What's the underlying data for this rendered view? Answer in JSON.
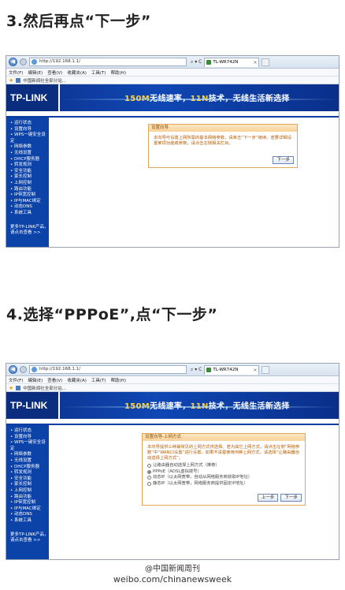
{
  "steps": [
    {
      "title": "3.然后再点“下一步”",
      "browser": {
        "url": "http://192.168.1.1/",
        "tab_title": "TL-WR742N",
        "menu": [
          "文件(F)",
          "编辑(E)",
          "查看(V)",
          "收藏夹(A)",
          "工具(T)",
          "帮助(H)"
        ],
        "favorites_item": "中国新闻社全部分站...",
        "tools_glyph": "⌕ ▾ C"
      },
      "page": {
        "logo": "TP-LINK",
        "slogan_a": "150M",
        "slogan_b": "无线速率，",
        "slogan_c": "11N",
        "slogan_d": "技术，无线生活新选择",
        "sidebar": [
          "运行状态",
          "设置向导",
          "WPS一键安全设定",
          "网络参数",
          "无线设置",
          "DHCP服务器",
          "转发规则",
          "安全功能",
          "家长控制",
          "上网控制",
          "路由功能",
          "IP带宽控制",
          "IP与MAC绑定",
          "动态DNS",
          "系统工具"
        ],
        "more": [
          "更多TP-LINK产品，",
          "请点击查看 >>"
        ],
        "dialog_title": "设置向导",
        "dialog_text": "本向导可设置上网所需的基本网络参数，请单击“下一步”继续。若要详细设置某项功能或参数，请点击左侧相关栏目。",
        "next_label": "下一步"
      }
    },
    {
      "title": "4.选择“PPPoE”,点“下一步”",
      "browser": {
        "url": "http://192.168.1.1/",
        "tab_title": "TL-WR742N",
        "menu": [
          "文件(F)",
          "编辑(E)",
          "查看(V)",
          "收藏夹(A)",
          "工具(T)",
          "帮助(H)"
        ],
        "favorites_item": "中国新闻社全部分站...",
        "tools_glyph": "⌕ ▾ C"
      },
      "page": {
        "logo": "TP-LINK",
        "slogan_a": "150M",
        "slogan_b": "无线速率，",
        "slogan_c": "11N",
        "slogan_d": "技术，无线生活新选择",
        "sidebar": [
          "运行状态",
          "设置向导",
          "WPS一键安全设定",
          "网络参数",
          "无线设置",
          "DHCP服务器",
          "转发规则",
          "安全功能",
          "家长控制",
          "上网控制",
          "路由功能",
          "IP带宽控制",
          "IP与MAC绑定",
          "动态DNS",
          "系统工具"
        ],
        "more": [
          "更多TP-LINK产品，",
          "请点击查看 >>"
        ],
        "dialog_title": "设置向导-上网方式",
        "dialog_text": "本向导提供三种最常见的上网方式供选择。若为其它上网方式，请点击左侧“网络参数”中“WAN口设置”进行设置。如果不清楚使用何种上网方式，请选择“让路由器自动选择上网方式”。",
        "options": [
          {
            "label": "让路由器自动选择上网方式（推荐）",
            "selected": false
          },
          {
            "label": "PPPoE（ADSL虚拟拨号）",
            "selected": true
          },
          {
            "label": "动态IP（以太网宽带，自动从网络服务商获取IP地址）",
            "selected": false
          },
          {
            "label": "静态IP（以太网宽带，网络服务商提供固定IP地址）",
            "selected": false
          }
        ],
        "prev_label": "上一步",
        "next_label": "下一步"
      }
    }
  ],
  "footer": {
    "handle": "@中国新闻周刊",
    "url": "weibo.com/chinanewsweek"
  }
}
